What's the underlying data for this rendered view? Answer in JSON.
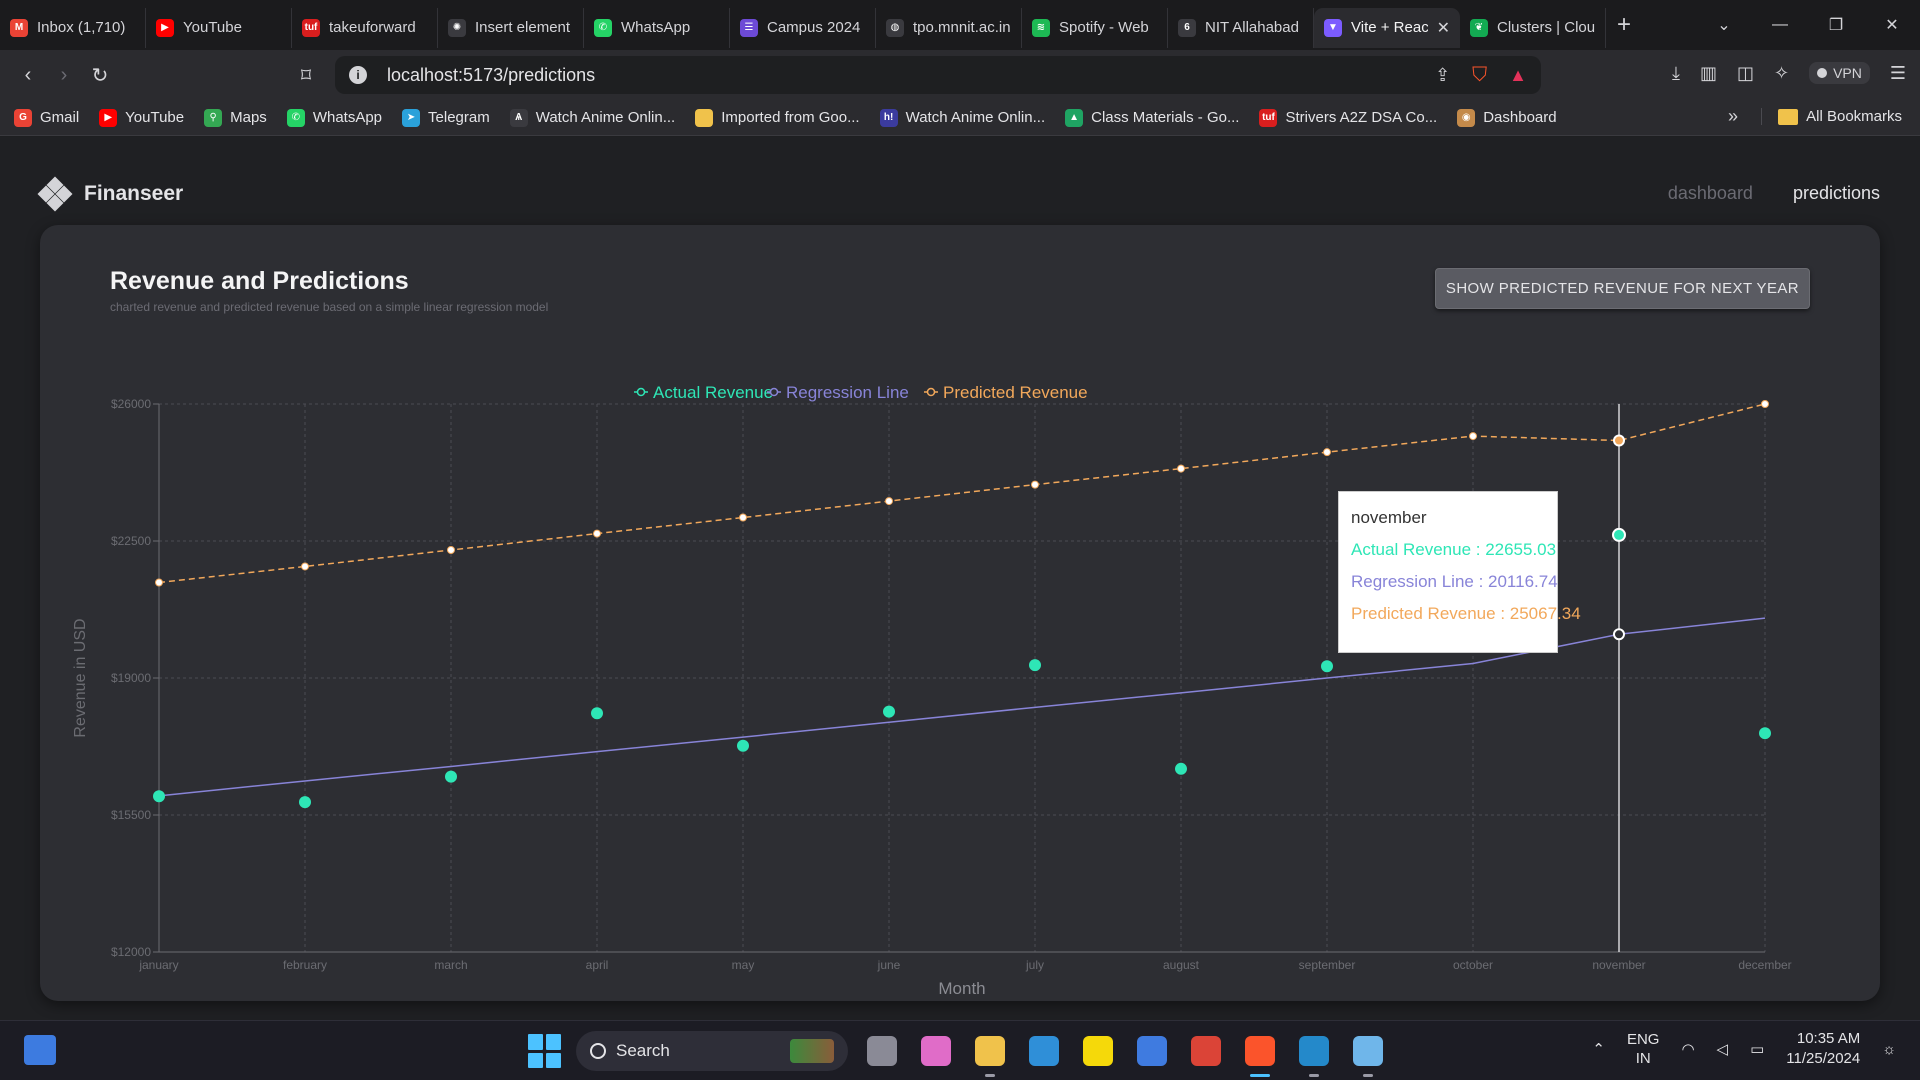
{
  "browser": {
    "tabs": [
      {
        "title": "Inbox (1,710)",
        "icon": "gmail-icon",
        "color": "#ea4335",
        "glyph": "M",
        "active": false
      },
      {
        "title": "YouTube",
        "icon": "youtube-icon",
        "color": "#ff0000",
        "glyph": "▶",
        "active": false
      },
      {
        "title": "takeuforward",
        "icon": "tuf-icon",
        "color": "#d91e1e",
        "glyph": "tuf",
        "active": false
      },
      {
        "title": "Insert element",
        "icon": "openai-icon",
        "color": "#3a3a3f",
        "glyph": "✺",
        "active": false
      },
      {
        "title": "WhatsApp",
        "icon": "whatsapp-icon",
        "color": "#25d366",
        "glyph": "✆",
        "active": false
      },
      {
        "title": "Campus 2024",
        "icon": "campus-icon",
        "color": "#6d4ad6",
        "glyph": "☰",
        "active": false
      },
      {
        "title": "tpo.mnnit.ac.in",
        "icon": "globe-icon",
        "color": "#3a3a3f",
        "glyph": "◍",
        "active": false
      },
      {
        "title": "Spotify - Web",
        "icon": "spotify-icon",
        "color": "#1db954",
        "glyph": "≋",
        "active": false
      },
      {
        "title": "NIT Allahabad",
        "icon": "nit-icon",
        "color": "#3a3a3f",
        "glyph": "6",
        "active": false
      },
      {
        "title": "Vite + React",
        "icon": "vite-icon",
        "color": "#7c5cff",
        "glyph": "▼",
        "active": true
      },
      {
        "title": "Clusters | Cloud",
        "icon": "mongodb-icon",
        "color": "#13aa52",
        "glyph": "❦",
        "active": false
      }
    ],
    "tab_close": "✕",
    "new_tab": "+",
    "url": "localhost:5173/predictions",
    "vpn_label": "VPN",
    "bookmarks": [
      {
        "label": "Gmail",
        "icon": "gmail-icon",
        "color": "#ea4335",
        "glyph": "G"
      },
      {
        "label": "YouTube",
        "icon": "youtube-icon",
        "color": "#ff0000",
        "glyph": "▶"
      },
      {
        "label": "Maps",
        "icon": "maps-icon",
        "color": "#34a853",
        "glyph": "⚲"
      },
      {
        "label": "WhatsApp",
        "icon": "whatsapp-icon",
        "color": "#25d366",
        "glyph": "✆"
      },
      {
        "label": "Telegram",
        "icon": "telegram-icon",
        "color": "#2aa1da",
        "glyph": "➤"
      },
      {
        "label": "Watch Anime Onlin...",
        "icon": "anime-icon",
        "color": "#3a3a3f",
        "glyph": "Ѧ"
      },
      {
        "label": "Imported from Goo...",
        "icon": "folder-icon",
        "color": "#f0c24b",
        "glyph": ""
      },
      {
        "label": "Watch Anime Onlin...",
        "icon": "anime2-icon",
        "color": "#3b3b9e",
        "glyph": "h!"
      },
      {
        "label": "Class Materials - Go...",
        "icon": "drive-icon",
        "color": "#1fa463",
        "glyph": "▲"
      },
      {
        "label": "Strivers A2Z DSA Co...",
        "icon": "tuf-icon",
        "color": "#d91e1e",
        "glyph": "tuf"
      },
      {
        "label": "Dashboard",
        "icon": "dashboard-icon",
        "color": "#c48a4a",
        "glyph": "◉"
      }
    ],
    "bookmarks_more": "»",
    "all_bookmarks": "All Bookmarks"
  },
  "app": {
    "name": "Finanseer",
    "nav": [
      {
        "label": "dashboard",
        "active": false
      },
      {
        "label": "predictions",
        "active": true
      }
    ]
  },
  "card": {
    "title": "Revenue and Predictions",
    "subtitle": "charted revenue and predicted revenue based on a simple linear regression model",
    "button": "SHOW PREDICTED REVENUE FOR NEXT YEAR"
  },
  "chart_data": {
    "type": "line",
    "xlabel": "Month",
    "ylabel": "Revenue in USD",
    "ylim": [
      12000,
      26000
    ],
    "y_ticks": [
      "$12000",
      "$15500",
      "$19000",
      "$22500",
      "$26000"
    ],
    "y_tick_values": [
      12000,
      15500,
      19000,
      22500,
      26000
    ],
    "categories": [
      "january",
      "february",
      "march",
      "april",
      "may",
      "june",
      "july",
      "august",
      "september",
      "october",
      "november",
      "december"
    ],
    "grid": true,
    "legend_position": "top-center",
    "series": [
      {
        "name": "Actual Revenue",
        "color": "#2ee6b6",
        "style": "scatter",
        "values": [
          15980,
          15830,
          16480,
          18100,
          17270,
          18140,
          19330,
          16680,
          19300,
          null,
          22655.03,
          17590
        ]
      },
      {
        "name": "Regression Line",
        "color": "#8884d8",
        "style": "line",
        "values": [
          15990,
          16370,
          16740,
          17120,
          17490,
          17870,
          18250,
          18620,
          19000,
          19370,
          20116.74,
          20530
        ]
      },
      {
        "name": "Predicted Revenue",
        "color": "#f2a85b",
        "style": "dashed",
        "values": [
          21440,
          21850,
          22270,
          22690,
          23100,
          23520,
          23940,
          24350,
          24770,
          25180,
          25067.34,
          26000
        ]
      }
    ],
    "tooltip": {
      "category": "november",
      "rows": [
        {
          "label": "Actual Revenue : 22655.03",
          "color": "#2ee6b6"
        },
        {
          "label": "Regression Line : 20116.74",
          "color": "#8884d8"
        },
        {
          "label": "Predicted Revenue : 25067.34",
          "color": "#f2a85b"
        }
      ]
    }
  },
  "taskbar": {
    "search_placeholder": "Search",
    "apps": [
      {
        "name": "task-view-icon",
        "color": "#8a8a96",
        "active": false
      },
      {
        "name": "copilot-icon",
        "color": "#e06cc8",
        "active": false
      },
      {
        "name": "file-explorer-icon",
        "color": "#f0c24b",
        "active": false,
        "open": true
      },
      {
        "name": "edge-icon",
        "color": "#2f8fd8",
        "active": false
      },
      {
        "name": "sticky-notes-icon",
        "color": "#f5d90a",
        "active": false
      },
      {
        "name": "microsoft-store-icon",
        "color": "#3f7be0",
        "active": false
      },
      {
        "name": "chrome-icon",
        "color": "#db4437",
        "active": false
      },
      {
        "name": "brave-icon",
        "color": "#fb542b",
        "active": true
      },
      {
        "name": "vscode-icon",
        "color": "#2489ca",
        "active": false,
        "open": true
      },
      {
        "name": "zoom-icon",
        "color": "#6fb6ea",
        "active": false,
        "open": true
      }
    ],
    "lang": "ENG",
    "region": "IN",
    "time": "10:35 AM",
    "date": "11/25/2024"
  }
}
